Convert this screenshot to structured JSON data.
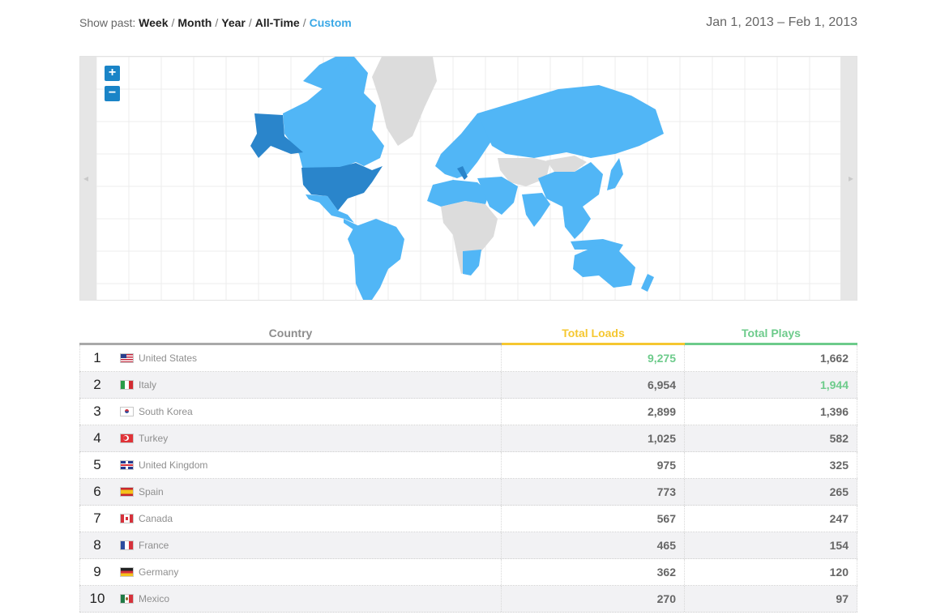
{
  "filter": {
    "label": "Show past:",
    "options": [
      "Week",
      "Month",
      "Year",
      "All-Time",
      "Custom"
    ],
    "active": "Custom"
  },
  "date_range": "Jan 1, 2013 – Feb 1, 2013",
  "map": {
    "zoom_in": "+",
    "zoom_out": "−",
    "colors": {
      "high": "#2a85cb",
      "medium": "#51b6f6",
      "none": "#dcdcdc",
      "grid": "#ececec"
    }
  },
  "table": {
    "headers": {
      "country": "Country",
      "loads": "Total Loads",
      "plays": "Total Plays"
    },
    "rows": [
      {
        "rank": "1",
        "flag": "us",
        "country": "United States",
        "loads": "9,275",
        "plays": "1,662",
        "highlight": "loads"
      },
      {
        "rank": "2",
        "flag": "it",
        "country": "Italy",
        "loads": "6,954",
        "plays": "1,944",
        "highlight": "plays"
      },
      {
        "rank": "3",
        "flag": "kr",
        "country": "South Korea",
        "loads": "2,899",
        "plays": "1,396",
        "highlight": ""
      },
      {
        "rank": "4",
        "flag": "tr",
        "country": "Turkey",
        "loads": "1,025",
        "plays": "582",
        "highlight": ""
      },
      {
        "rank": "5",
        "flag": "gb",
        "country": "United Kingdom",
        "loads": "975",
        "plays": "325",
        "highlight": ""
      },
      {
        "rank": "6",
        "flag": "es",
        "country": "Spain",
        "loads": "773",
        "plays": "265",
        "highlight": ""
      },
      {
        "rank": "7",
        "flag": "ca",
        "country": "Canada",
        "loads": "567",
        "plays": "247",
        "highlight": ""
      },
      {
        "rank": "8",
        "flag": "fr",
        "country": "France",
        "loads": "465",
        "plays": "154",
        "highlight": ""
      },
      {
        "rank": "9",
        "flag": "de",
        "country": "Germany",
        "loads": "362",
        "plays": "120",
        "highlight": ""
      },
      {
        "rank": "10",
        "flag": "mx",
        "country": "Mexico",
        "loads": "270",
        "plays": "97",
        "highlight": ""
      }
    ]
  }
}
